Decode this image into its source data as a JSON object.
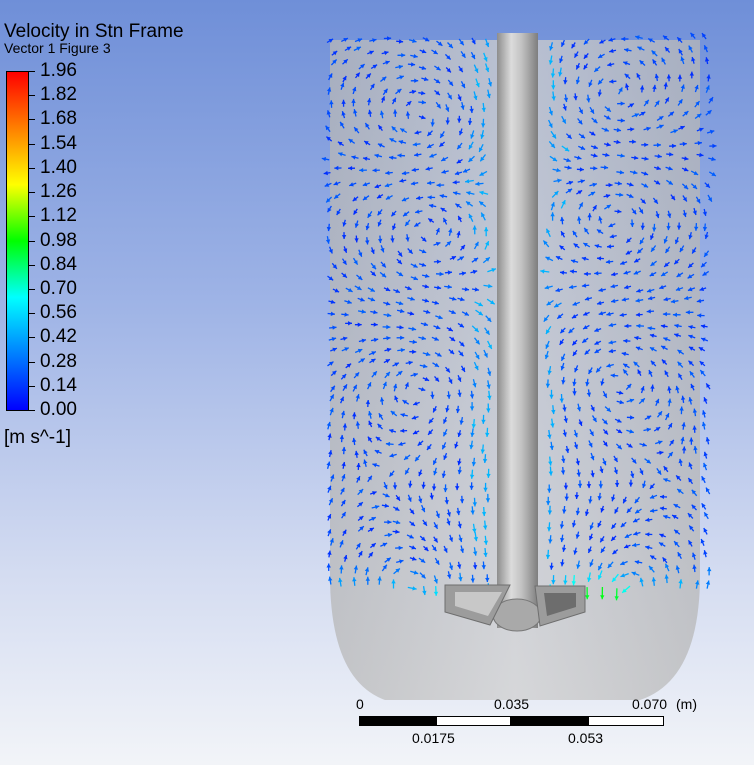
{
  "header": {
    "title": "Velocity in Stn Frame",
    "subtitle": "Vector 1 Figure 3"
  },
  "legend": {
    "labels": [
      "1.96",
      "1.82",
      "1.68",
      "1.54",
      "1.40",
      "1.26",
      "1.12",
      "0.98",
      "0.84",
      "0.70",
      "0.56",
      "0.42",
      "0.28",
      "0.14",
      "0.00"
    ],
    "unit": "[m s^-1]",
    "colors": [
      "#ff0000",
      "#ff8000",
      "#ffff00",
      "#00ff00",
      "#00ffff",
      "#0080ff",
      "#0000ff"
    ]
  },
  "scale_bar": {
    "top_labels": [
      "0",
      "0.035",
      "0.070",
      "(m)"
    ],
    "bottom_labels": [
      "0.0175",
      "0.053"
    ]
  },
  "colors": {
    "shaft": "#b9b9b9",
    "tank": "#c3c3c3"
  }
}
